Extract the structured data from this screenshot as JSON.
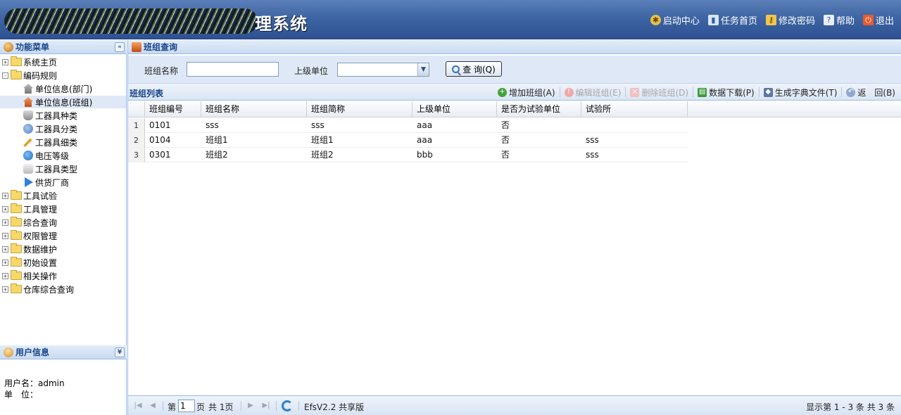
{
  "header": {
    "title_visible": "理系统",
    "nav": [
      {
        "label": "启动中心",
        "icon": "gear-icon"
      },
      {
        "label": "任务首页",
        "icon": "chart-icon"
      },
      {
        "label": "修改密码",
        "icon": "key-icon"
      },
      {
        "label": "帮助",
        "icon": "help-icon"
      },
      {
        "label": "退出",
        "icon": "exit-icon"
      }
    ]
  },
  "sidebar": {
    "title": "功能菜单",
    "tree": [
      {
        "label": "系统主页",
        "expander": "+"
      },
      {
        "label": "编码规则",
        "expander": "-"
      },
      {
        "label": "单位信息(部门)"
      },
      {
        "label": "单位信息(班组)"
      },
      {
        "label": "工器具种类"
      },
      {
        "label": "工器具分类"
      },
      {
        "label": "工器具细类"
      },
      {
        "label": "电压等级"
      },
      {
        "label": "工器具类型"
      },
      {
        "label": "供货厂商"
      },
      {
        "label": "工具试验",
        "expander": "+"
      },
      {
        "label": "工具管理",
        "expander": "+"
      },
      {
        "label": "综合查询",
        "expander": "+"
      },
      {
        "label": "权限管理",
        "expander": "+"
      },
      {
        "label": "数据维护",
        "expander": "+"
      },
      {
        "label": "初始设置",
        "expander": "+"
      },
      {
        "label": "相关操作",
        "expander": "+"
      },
      {
        "label": "仓库综合查询",
        "expander": "+"
      }
    ],
    "selected": "单位信息(班组)"
  },
  "user_panel": {
    "title": "用户信息",
    "username_label": "用户名：",
    "username": "admin",
    "unit_label": "单　位："
  },
  "main": {
    "title": "班组查询",
    "query": {
      "name_label": "班组名称",
      "name_value": "",
      "unit_label": "上级单位",
      "unit_value": "",
      "button": "查 询(Q)"
    },
    "grid_title": "班组列表",
    "toolbar": {
      "add": "增加班组(A)",
      "edit": "编辑班组(E)",
      "delete": "删除班组(D)",
      "download": "数据下载(P)",
      "dict": "生成字典文件(T)",
      "back": "返　回(B)"
    },
    "columns": [
      "班组编号",
      "班组名称",
      "班组简称",
      "上级单位",
      "是否为试验单位",
      "试验所"
    ],
    "rows": [
      {
        "n": "1",
        "cells": [
          "0101",
          "sss",
          "sss",
          "aaa",
          "否",
          ""
        ]
      },
      {
        "n": "2",
        "cells": [
          "0104",
          "班组1",
          "班组1",
          "aaa",
          "否",
          "sss"
        ]
      },
      {
        "n": "3",
        "cells": [
          "0301",
          "班组2",
          "班组2",
          "bbb",
          "否",
          "sss"
        ]
      }
    ],
    "pager": {
      "page_prefix": "第",
      "page": "1",
      "page_suffix": "页",
      "total_pages": "共 1页",
      "version": "EfsV2.2 共享版",
      "summary": "显示第 1 - 3 条  共 3 条"
    }
  }
}
